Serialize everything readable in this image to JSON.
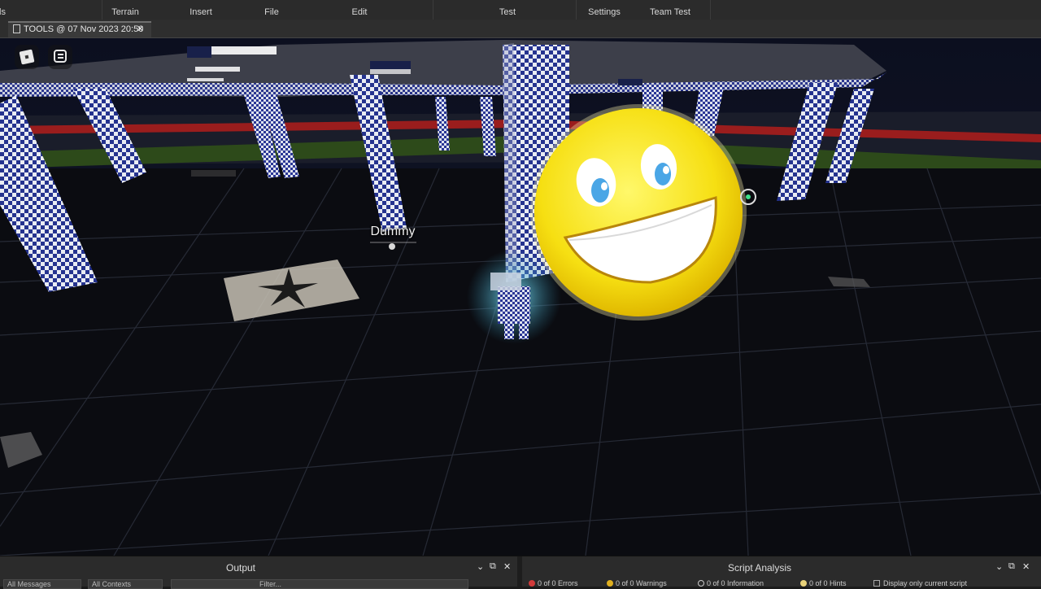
{
  "menubar": {
    "items": [
      {
        "label": "ls"
      },
      {
        "label": "Terrain"
      },
      {
        "label": "Insert"
      },
      {
        "label": "File"
      },
      {
        "label": "Edit"
      },
      {
        "label": "Test"
      },
      {
        "label": "Settings"
      },
      {
        "label": "Team Test"
      }
    ]
  },
  "tabs": [
    {
      "label": "TOOLS @ 07 Nov 2023 20:50",
      "close": "✕"
    }
  ],
  "viewport": {
    "roblox_button": "roblox-logo-icon",
    "chat_button": "chat-icon",
    "character_label": "Dummy"
  },
  "output_panel": {
    "title": "Output",
    "field1": "All Messages",
    "field2": "All Contexts",
    "filter_placeholder": "Filter..."
  },
  "script_analysis_panel": {
    "title": "Script Analysis",
    "errors": "0 of 0 Errors",
    "warnings": "0 of 0 Warnings",
    "information": "0 of 0 Information",
    "hints": "0 of 0 Hints",
    "display_only": "Display only current script"
  },
  "colors": {
    "menubar_bg": "#2b2b2b",
    "smiley_yellow": "#f7e21a",
    "checker_blue": "#1c2a8a",
    "floor": "#0c0c10",
    "error_red": "#d23b3b",
    "warning_yellow": "#e0b020"
  }
}
